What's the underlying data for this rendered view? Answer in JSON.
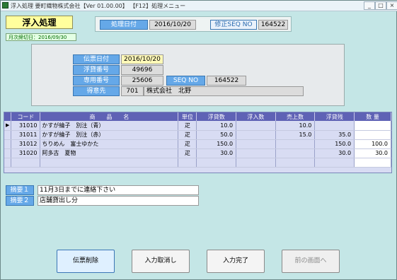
{
  "window": {
    "title": "浮入処理 要町織物株式会社【Ver 01.00.00】 【F12】処理メニュー",
    "controls": {
      "minimize": "_",
      "restore": "□",
      "close": "×"
    }
  },
  "header": {
    "screen_title": "浮入処理",
    "month_close": "月次締切日：2016/09/30",
    "process_date_label": "処理日付",
    "process_date_value": "2016/10/20",
    "seq_label": "修正SEQ NO",
    "seq_value": "164522"
  },
  "form": {
    "slip_date_label": "伝票日付",
    "slip_date_value": "2016/10/20",
    "loan_no_label": "浮貸番号",
    "loan_no_value": "49696",
    "exclusive_no_label": "専用番号",
    "exclusive_no_value": "25606",
    "seqno_label": "SEQ NO",
    "seqno_value": "164522",
    "customer_label": "得意先",
    "customer_code": "701",
    "customer_name": "株式会社　北野"
  },
  "table": {
    "headers": [
      "コード",
      "商　　品　　名",
      "単位",
      "浮貸数",
      "浮入数",
      "売上数",
      "浮貸残",
      "数 量"
    ],
    "rows": [
      {
        "selected": true,
        "code": "31010",
        "name": "かすが綸子　別注（青）",
        "unit": "疋",
        "loan": "10.0",
        "in": "",
        "sales": "10.0",
        "balance": "",
        "qty": ""
      },
      {
        "selected": false,
        "code": "31011",
        "name": "かすが綸子　別注（赤）",
        "unit": "疋",
        "loan": "50.0",
        "in": "",
        "sales": "15.0",
        "balance": "35.0",
        "qty": ""
      },
      {
        "selected": false,
        "code": "31012",
        "name": "ちりめん　富士ゆかた",
        "unit": "疋",
        "loan": "150.0",
        "in": "",
        "sales": "",
        "balance": "150.0",
        "qty": "100.0"
      },
      {
        "selected": false,
        "code": "31020",
        "name": "阿多古　夏物",
        "unit": "疋",
        "loan": "30.0",
        "in": "",
        "sales": "",
        "balance": "30.0",
        "qty": "30.0"
      },
      {
        "selected": false,
        "code": "",
        "name": "",
        "unit": "",
        "loan": "",
        "in": "",
        "sales": "",
        "balance": "",
        "qty": ""
      }
    ]
  },
  "memos": {
    "memo1_label": "摘要１",
    "memo1_value": "11月3日までに連絡下さい",
    "memo2_label": "摘要２",
    "memo2_value": "店舗貸出し分"
  },
  "buttons": {
    "delete": "伝票削除",
    "cancel": "入力取消し",
    "complete": "入力完了",
    "back": "前の画面へ"
  }
}
